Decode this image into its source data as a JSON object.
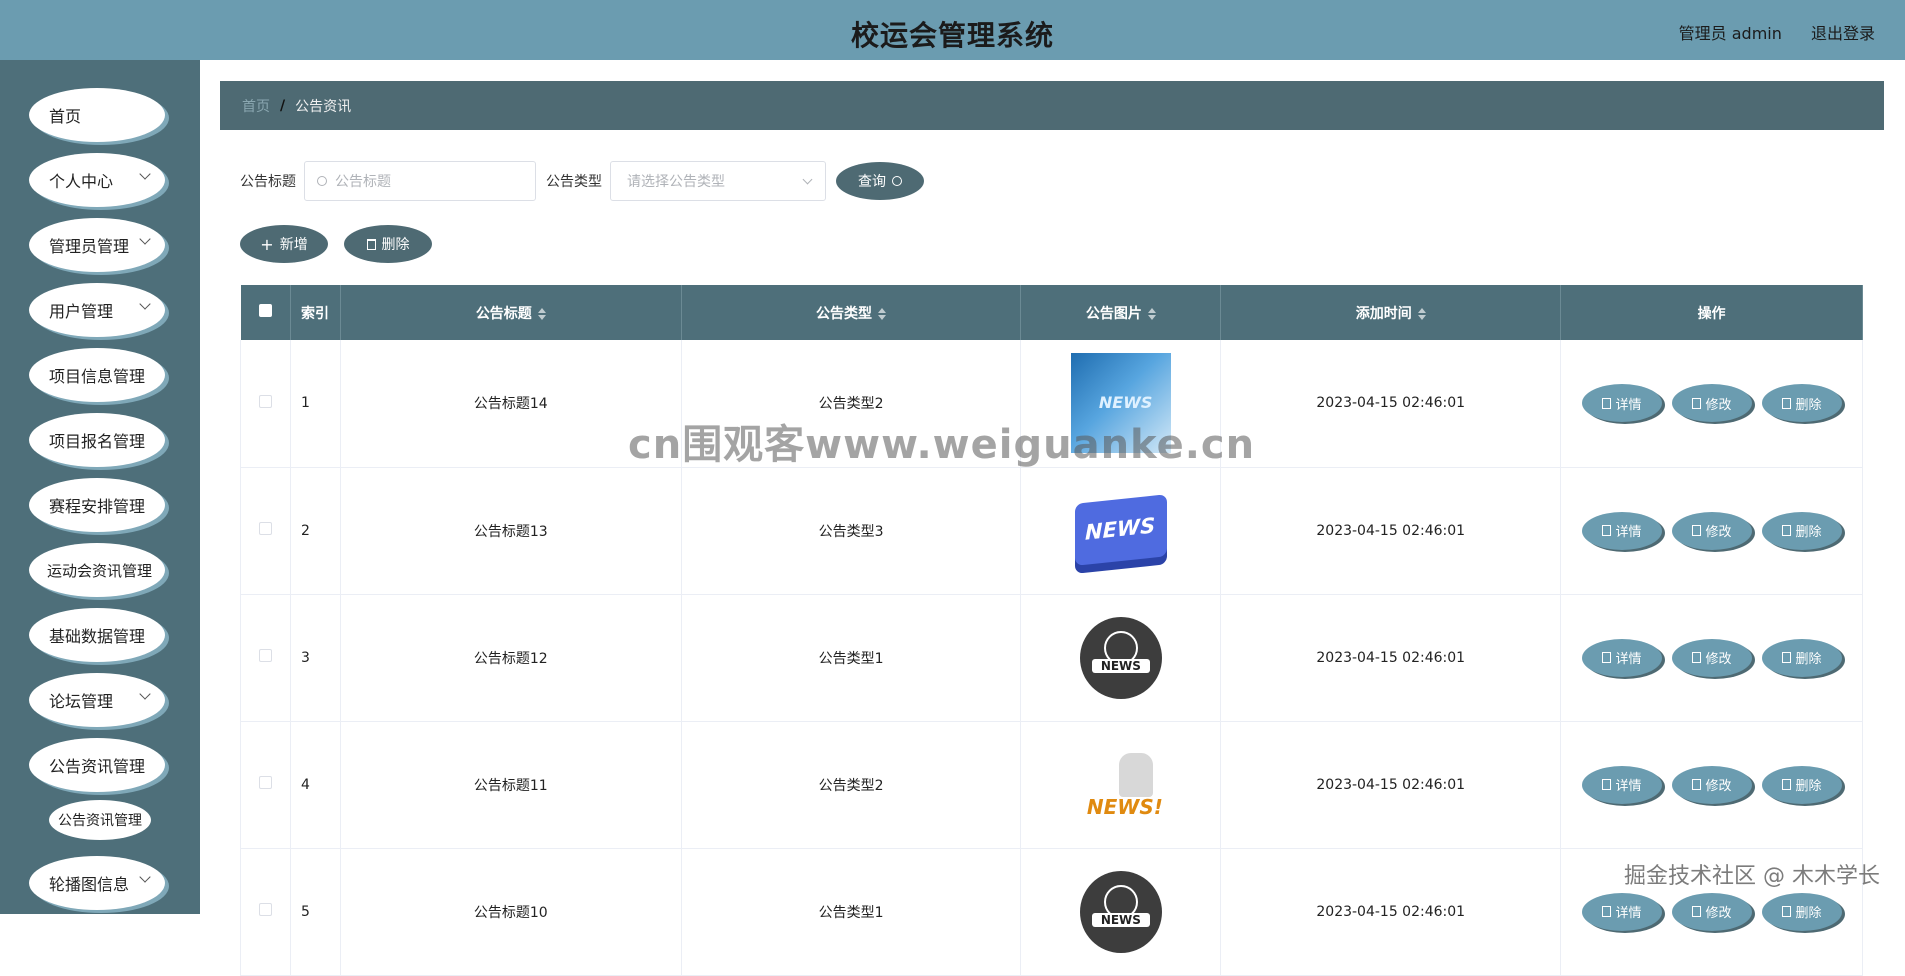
{
  "header": {
    "title": "校运会管理系统",
    "user_label": "管理员 admin",
    "logout_label": "退出登录"
  },
  "sidebar": {
    "items": [
      {
        "label": "首页",
        "has_children": false
      },
      {
        "label": "个人中心",
        "has_children": true
      },
      {
        "label": "管理员管理",
        "has_children": true
      },
      {
        "label": "用户管理",
        "has_children": true
      },
      {
        "label": "项目信息管理",
        "has_children": false
      },
      {
        "label": "项目报名管理",
        "has_children": false
      },
      {
        "label": "赛程安排管理",
        "has_children": false
      },
      {
        "label": "运动会资讯管理",
        "has_children": false
      },
      {
        "label": "基础数据管理",
        "has_children": false
      },
      {
        "label": "论坛管理",
        "has_children": true
      },
      {
        "label": "公告资讯管理",
        "has_children": false
      },
      {
        "label": "轮播图信息",
        "has_children": true
      }
    ],
    "active_sub_item": "公告资讯管理"
  },
  "breadcrumb": {
    "home": "首页",
    "separator": "/",
    "current": "公告资讯"
  },
  "search": {
    "title_label": "公告标题",
    "title_placeholder": "公告标题",
    "type_label": "公告类型",
    "type_placeholder": "请选择公告类型",
    "search_button": "查询"
  },
  "actions": {
    "add_button": "新增",
    "delete_button": "删除"
  },
  "table": {
    "headers": [
      "索引",
      "公告标题",
      "公告类型",
      "公告图片",
      "添加时间",
      "操作"
    ],
    "rows": [
      {
        "index": "1",
        "title": "公告标题14",
        "type": "公告类型2",
        "image_icon": "news-blue-banner-image",
        "time": "2023-04-15 02:46:01"
      },
      {
        "index": "2",
        "title": "公告标题13",
        "type": "公告类型3",
        "image_icon": "news-key-image",
        "time": "2023-04-15 02:46:01"
      },
      {
        "index": "3",
        "title": "公告标题12",
        "type": "公告类型1",
        "image_icon": "news-globe-badge-image",
        "time": "2023-04-15 02:46:01"
      },
      {
        "index": "4",
        "title": "公告标题11",
        "type": "公告类型2",
        "image_icon": "news-figure-image",
        "time": "2023-04-15 02:46:01"
      },
      {
        "index": "5",
        "title": "公告标题10",
        "type": "公告类型1",
        "image_icon": "news-globe-badge-image",
        "time": "2023-04-15 02:46:01"
      }
    ],
    "row_actions": {
      "detail": "详情",
      "edit": "修改",
      "delete": "删除"
    }
  },
  "thumb_text": {
    "news_upper": "NEWS",
    "news_mixed": "NEWS!"
  },
  "watermarks": {
    "center": "cn围观客www.weiguanke.cn",
    "corner": "掘金技术社区 @ 木木学长"
  },
  "colors": {
    "header_bg": "#6b9cb0",
    "sidebar_bg": "#4e6f7a",
    "accent": "#4e6a73"
  }
}
